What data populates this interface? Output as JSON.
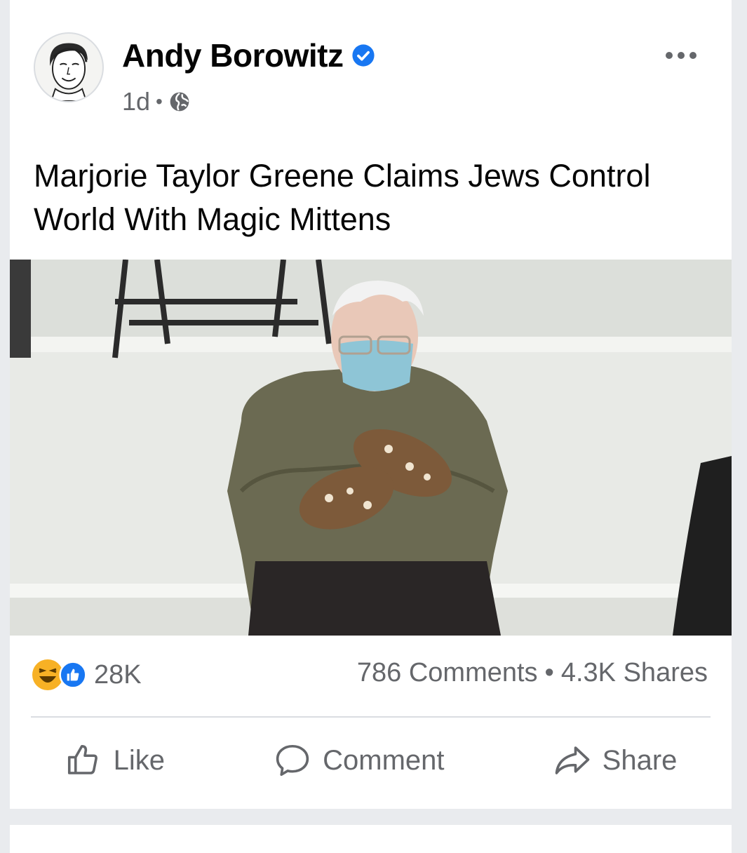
{
  "post": {
    "author": "Andy Borowitz",
    "timestamp": "1d",
    "privacy_icon": "globe-icon",
    "headline": "Marjorie Taylor Greene Claims Jews Control World With Magic Mittens",
    "reactions": {
      "icons": [
        "haha-reaction-icon",
        "like-reaction-icon"
      ],
      "count": "28K"
    },
    "comments_count": "786 Comments",
    "separator": "•",
    "shares_count": "4.3K Shares"
  },
  "actions": {
    "like_label": "Like",
    "comment_label": "Comment",
    "share_label": "Share"
  },
  "colors": {
    "background": "#e9ebee",
    "card": "#ffffff",
    "text_primary": "#050505",
    "text_secondary": "#65676b",
    "verified_blue": "#1877f2",
    "haha_yellow": "#f7b125"
  }
}
